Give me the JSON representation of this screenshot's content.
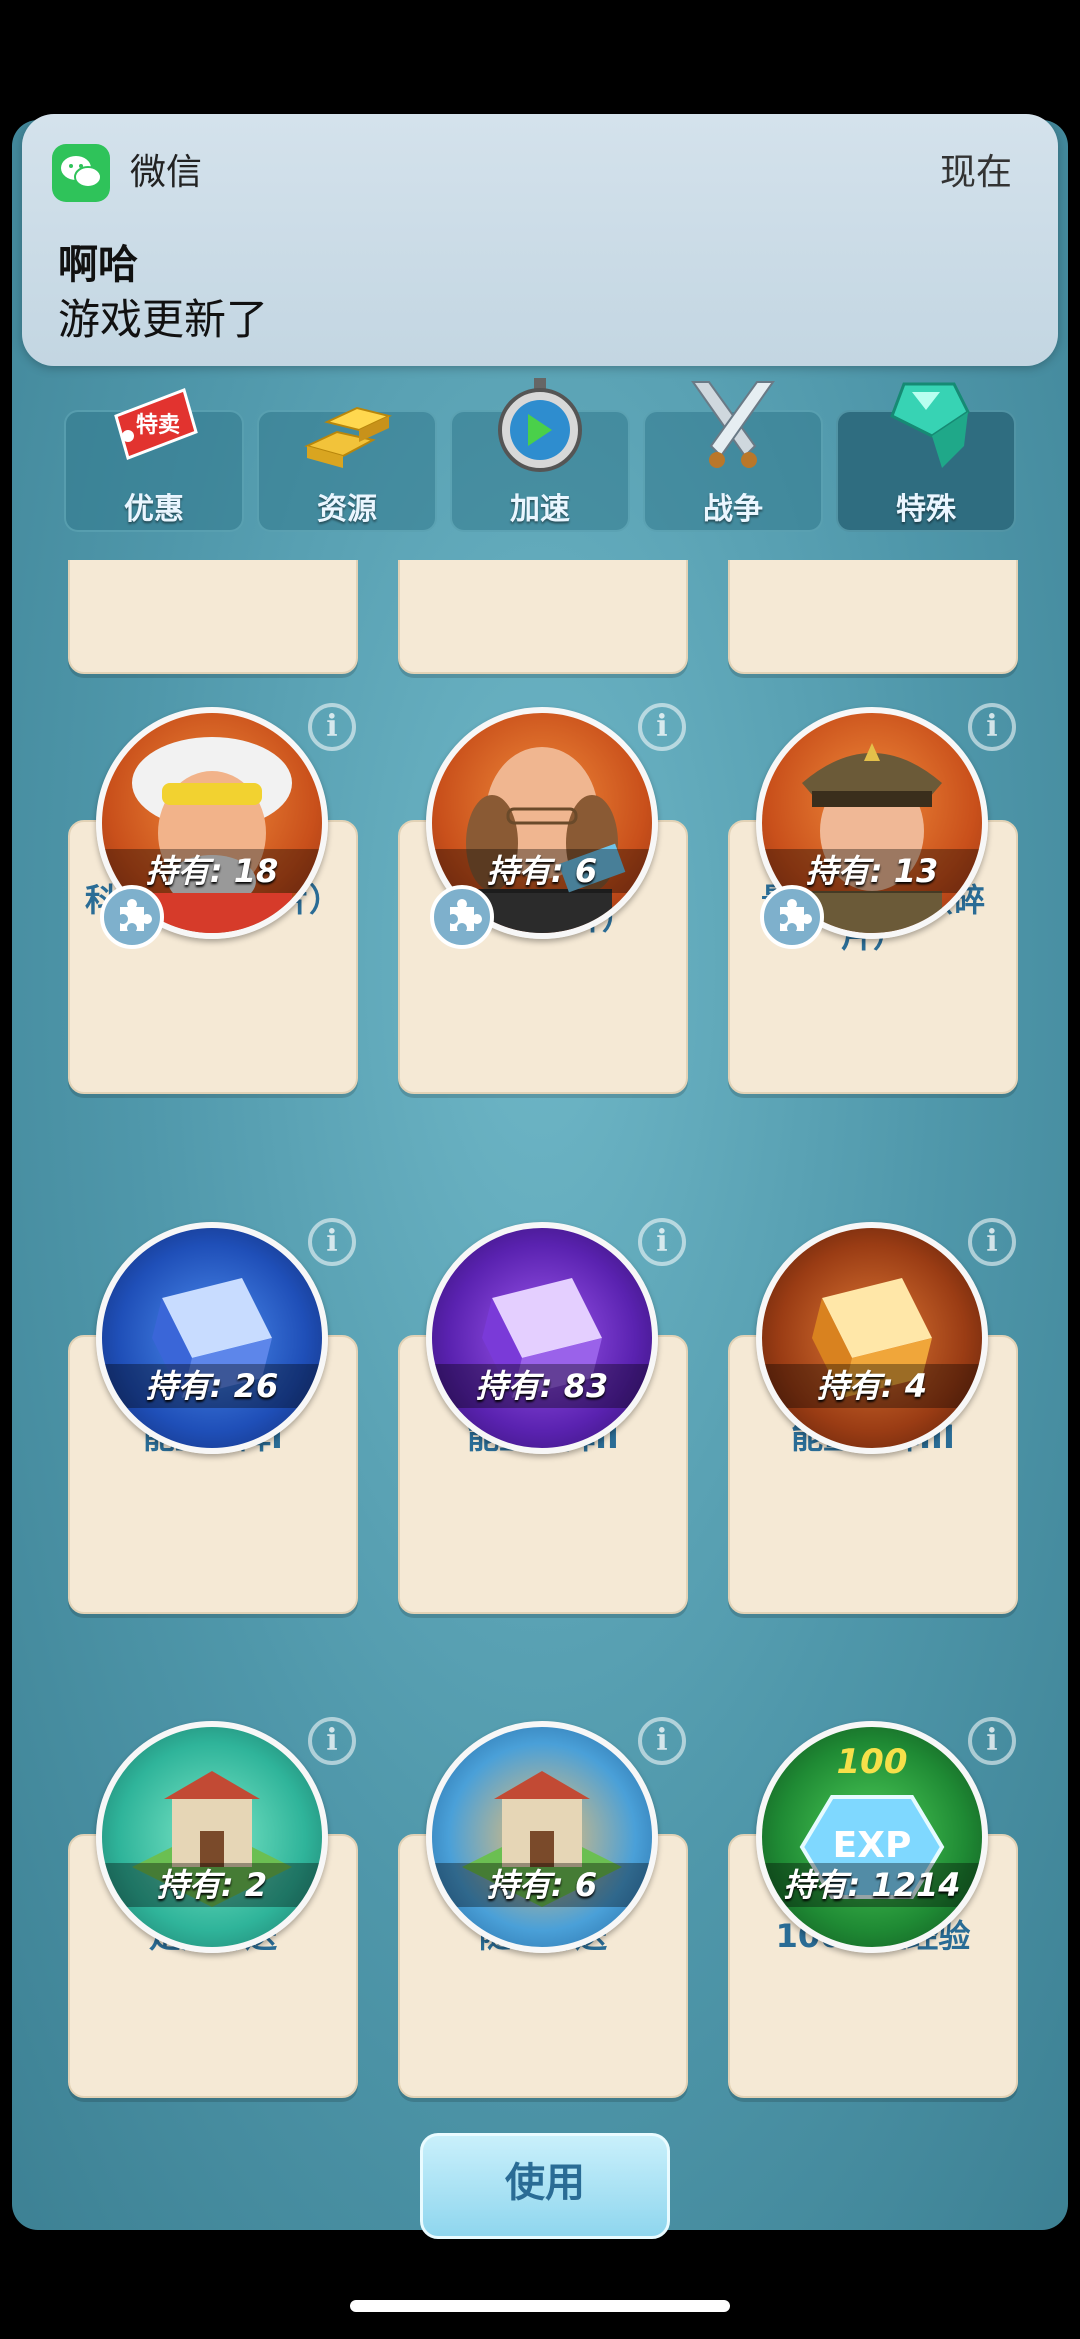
{
  "notification": {
    "app": "微信",
    "time": "现在",
    "title": "啊哈",
    "body": "游戏更新了"
  },
  "tabs": [
    {
      "label": "优惠",
      "icon": "sale-tag-icon",
      "badge": "特卖"
    },
    {
      "label": "资源",
      "icon": "gold-bars-icon"
    },
    {
      "label": "加速",
      "icon": "stopwatch-icon"
    },
    {
      "label": "战争",
      "icon": "crossed-swords-icon"
    },
    {
      "label": "特殊",
      "icon": "green-gem-icon",
      "active": true
    }
  ],
  "rows": [
    {
      "items": [
        {
          "name": "科学怪人（碎片）",
          "holding": "持有: 18",
          "icon": "scientist-portrait",
          "fragment": true
        },
        {
          "name": "EM（碎片）",
          "holding": "持有: 6",
          "icon": "old-gentleman-portrait",
          "fragment": true
        },
        {
          "name": "最高指挥官（碎片）",
          "holding": "持有: 13",
          "icon": "commander-portrait",
          "fragment": true
        }
      ]
    },
    {
      "items": [
        {
          "name": "能量矩阵I",
          "holding": "持有: 26",
          "icon": "blue-cube-icon",
          "color": "#2b5fd8"
        },
        {
          "name": "能量矩阵II",
          "holding": "持有: 83",
          "icon": "purple-cube-icon",
          "color": "#6a2fc0"
        },
        {
          "name": "能量矩阵III",
          "holding": "持有: 4",
          "icon": "orange-cube-icon",
          "color": "#c0581e"
        }
      ]
    },
    {
      "items": [
        {
          "name": "定点传送",
          "holding": "持有: 2",
          "icon": "teleport-building-icon"
        },
        {
          "name": "随机传送",
          "holding": "持有: 6",
          "icon": "teleport-building-icon"
        },
        {
          "name": "100泰坦经验",
          "holding": "持有: 1214",
          "icon": "exp-crystal-icon",
          "badge": "100"
        }
      ]
    }
  ],
  "use_button": "使用"
}
